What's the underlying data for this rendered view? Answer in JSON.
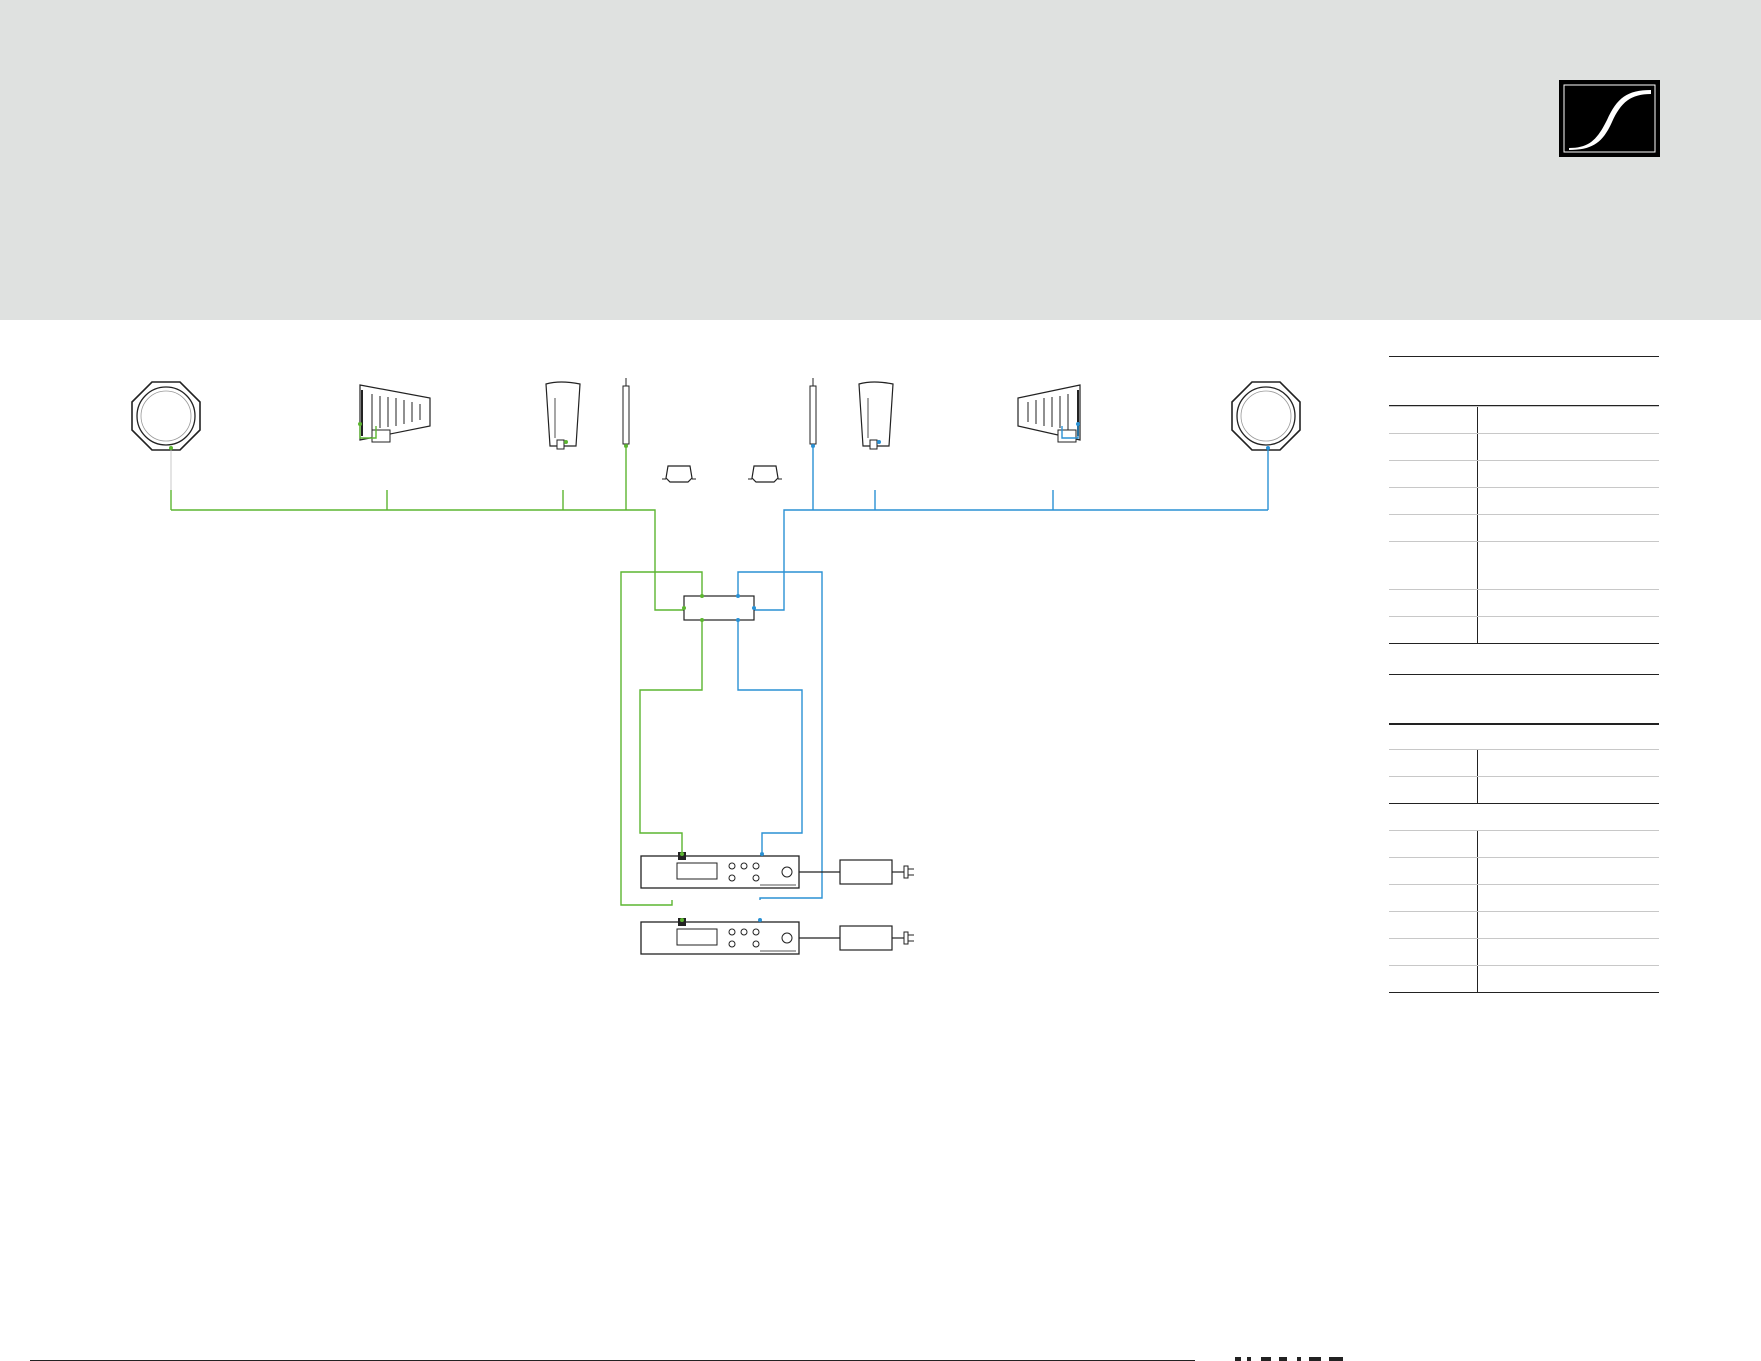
{
  "brand": {
    "logo_icon": "sennheiser-logo-icon",
    "colors": {
      "header_bg": "#dfe1e0",
      "channel_a": "#5cb531",
      "channel_b": "#2a91d4",
      "ink": "#1a1a1a"
    }
  },
  "diagram": {
    "left_channel": [
      "dome-antenna-icon",
      "directional-antenna-icon",
      "halfwave-antenna-icon",
      "rod-antenna-icon"
    ],
    "right_channel": [
      "rod-antenna-icon",
      "halfwave-antenna-icon",
      "directional-antenna-icon",
      "dome-antenna-icon"
    ],
    "booster_icons": [
      "antenna-booster-icon",
      "antenna-booster-icon"
    ],
    "splitter_icon": "antenna-splitter-icon",
    "receivers": [
      "rack-receiver-icon",
      "rack-receiver-icon"
    ],
    "power_supplies": [
      "power-supply-icon",
      "power-supply-icon"
    ]
  },
  "side_table": {
    "group1_rows": 10,
    "group2_rows_a": 3,
    "group2_rows_b": 6
  }
}
